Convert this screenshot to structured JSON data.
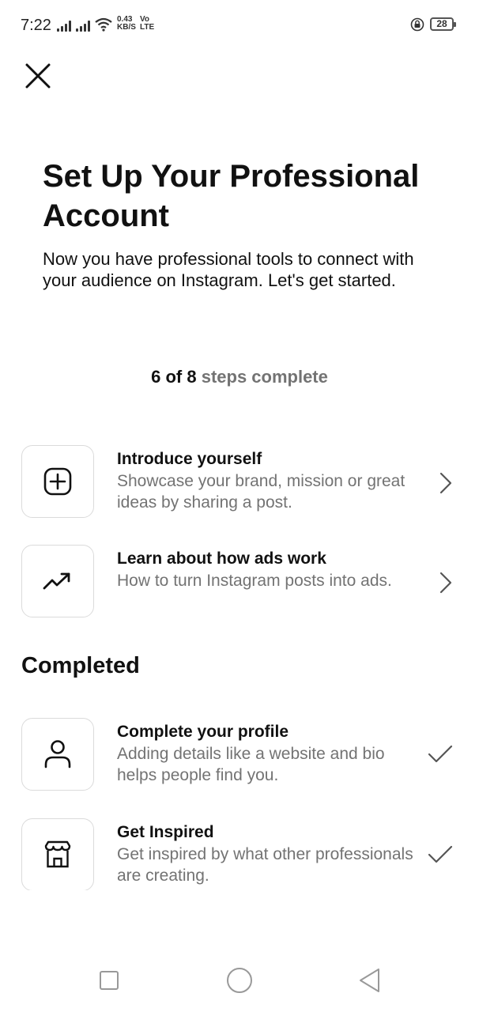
{
  "status_bar": {
    "time": "7:22",
    "net_speed_value": "0.43",
    "net_speed_unit": "KB/S",
    "network_top": "Vo",
    "network_bottom": "LTE",
    "battery": "28"
  },
  "header": {
    "title": "Set Up Your Professional Account",
    "subtitle": "Now you have professional tools to connect with your audience on Instagram. Let's get started."
  },
  "progress": {
    "completed": "6 of 8",
    "label": "steps complete"
  },
  "todo_tasks": [
    {
      "title": "Introduce yourself",
      "description": "Showcase your brand, mission or great ideas by sharing a post.",
      "icon": "plus-square-icon"
    },
    {
      "title": "Learn about how ads work",
      "description": "How to turn Instagram posts into ads.",
      "icon": "trending-up-icon"
    }
  ],
  "completed_section": {
    "heading": "Completed",
    "tasks": [
      {
        "title": "Complete your profile",
        "description": "Adding details like a website and bio helps people find you.",
        "icon": "person-icon"
      },
      {
        "title": "Get Inspired",
        "description": "Get inspired by what other professionals are creating.",
        "icon": "storefront-icon"
      }
    ]
  },
  "colors": {
    "primary_text": "#111111",
    "secondary_text": "#737373",
    "border": "#dbdbdb",
    "background": "#ffffff"
  }
}
